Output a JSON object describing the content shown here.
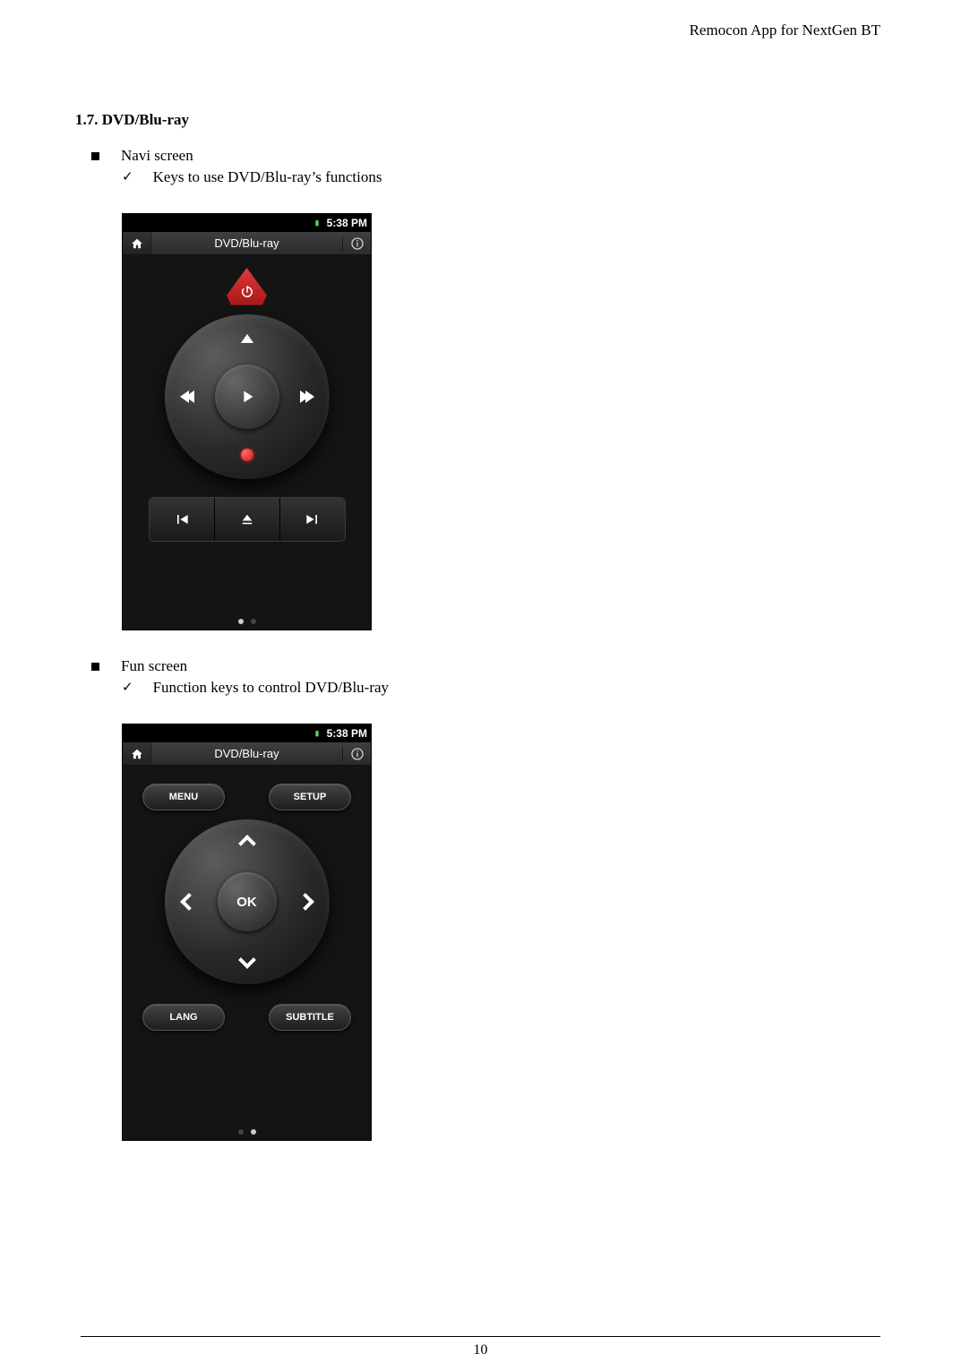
{
  "header": {
    "right": "Remocon App for NextGen BT"
  },
  "section": {
    "heading": "1.7. DVD/Blu-ray"
  },
  "bullets": {
    "navi": "Navi screen",
    "navi_sub": "Keys to use DVD/Blu-ray’s functions",
    "fun": "Fun screen",
    "fun_sub": "Function keys to control DVD/Blu-ray"
  },
  "phone": {
    "status_time": "5:38 PM",
    "title": "DVD/Blu-ray"
  },
  "fun_buttons": {
    "menu": "MENU",
    "setup": "SETUP",
    "ok": "OK",
    "lang": "LANG",
    "subtitle": "SUBTITLE"
  },
  "footer": {
    "page": "10"
  }
}
